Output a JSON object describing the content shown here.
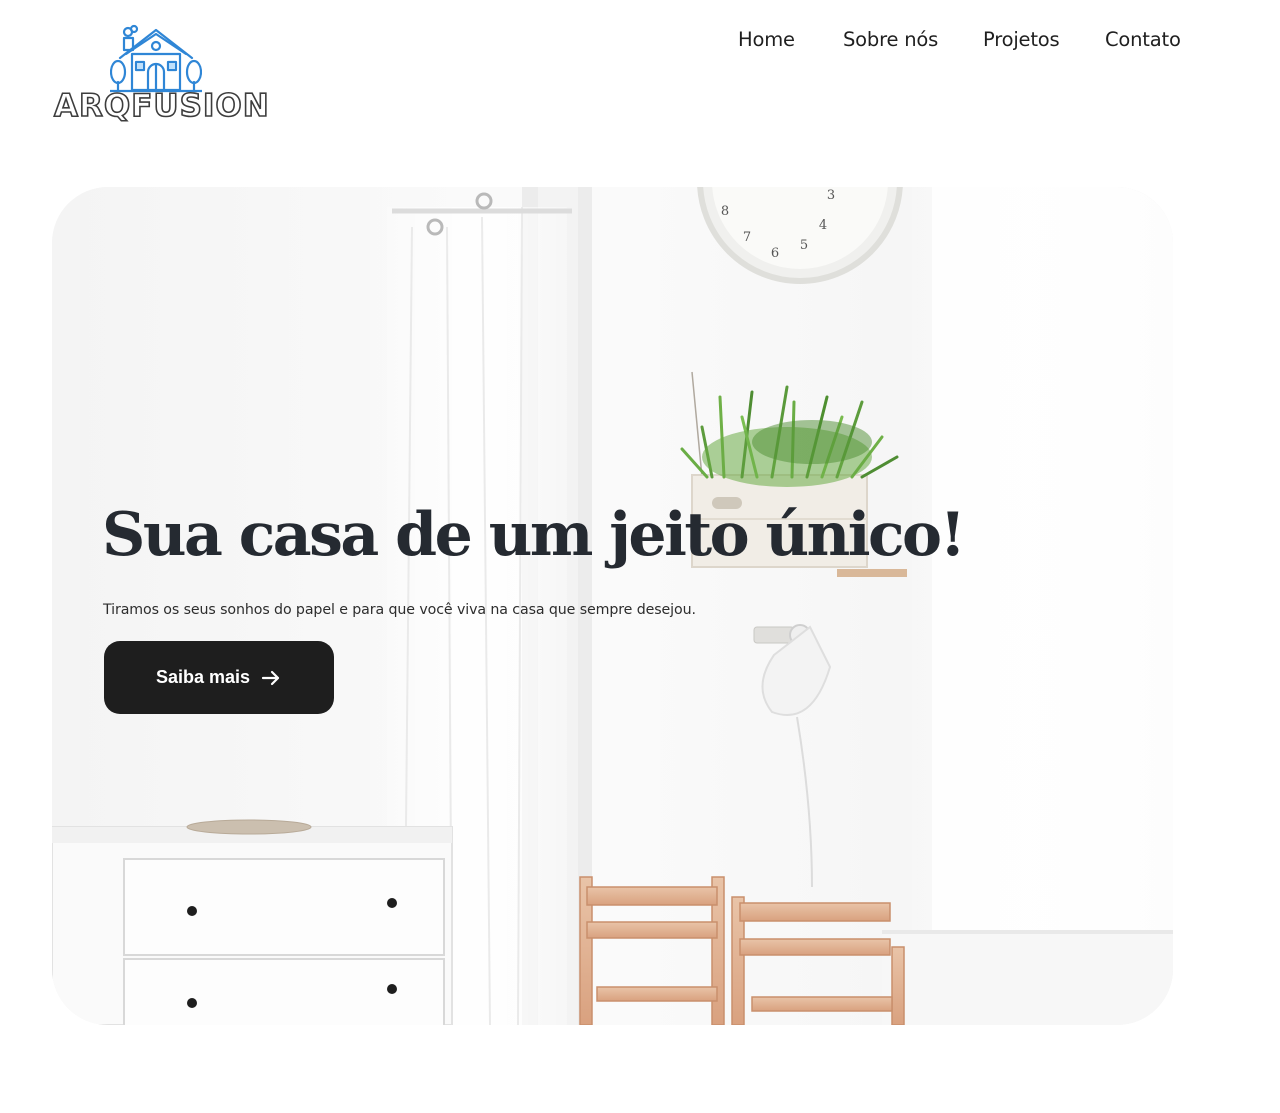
{
  "brand": {
    "name": "ARQFUSION",
    "logo_icon": "house-icon",
    "logo_color": "#2f86d6"
  },
  "nav": {
    "items": [
      "Home",
      "Sobre nós",
      "Projetos",
      "Contato"
    ]
  },
  "hero": {
    "title": "Sua casa de um jeito único!",
    "subtitle": "Tiramos os seus sonhos do papel e para que você viva na casa que sempre desejou.",
    "cta_label": "Saiba mais",
    "cta_icon": "arrow-right-icon",
    "cta_color": "#1e1e1e",
    "title_color": "#252a31",
    "clock_numbers": [
      "8",
      "7",
      "6",
      "5",
      "4",
      "3"
    ]
  }
}
